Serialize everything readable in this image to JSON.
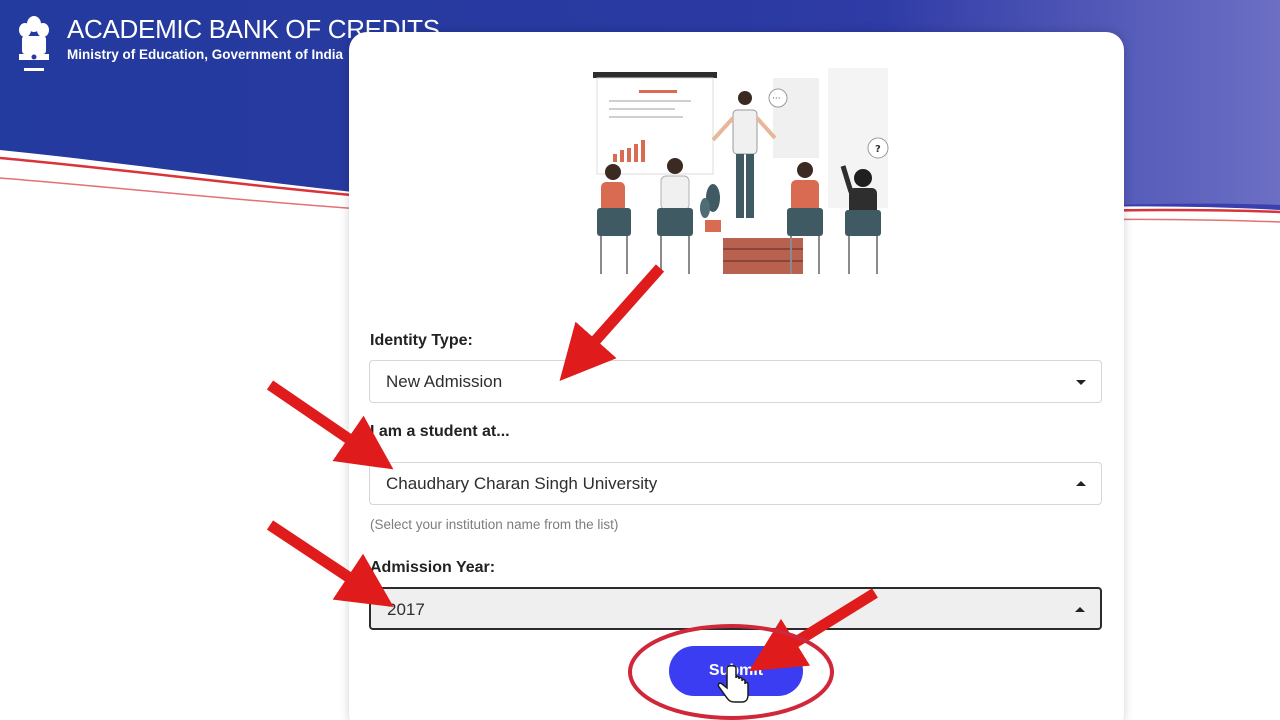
{
  "header": {
    "title": "ACADEMIC BANK OF CREDITS",
    "subtitle": "Ministry of Education, Government of India",
    "emblem_icon": "national-emblem-icon"
  },
  "form": {
    "identity_type": {
      "label": "Identity Type:",
      "value": "New Admission",
      "caret_icon": "caret-down-icon"
    },
    "institution": {
      "label": "I am a student at...",
      "value": "Chaudhary Charan Singh University",
      "hint": "(Select your institution name from the list)",
      "caret_icon": "caret-up-icon"
    },
    "admission_year": {
      "label": "Admission Year:",
      "value": "2017",
      "caret_icon": "caret-up-icon"
    },
    "submit_label": "Submit"
  },
  "colors": {
    "brand_blue": "#2b3a9f",
    "accent_red": "#d9343a",
    "submit_blue": "#3a3df2",
    "annotation_red": "#e01b1b"
  }
}
